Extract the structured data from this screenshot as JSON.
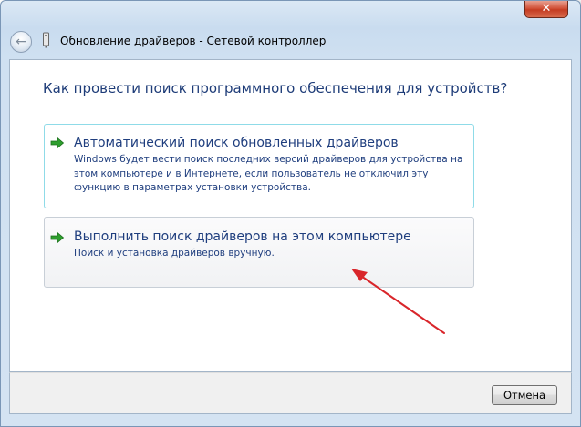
{
  "window": {
    "title": "Обновление драйверов - Сетевой контроллер",
    "close_label": "✕",
    "back_icon": "back-arrow-icon",
    "device_icon": "network-controller-icon"
  },
  "content": {
    "heading": "Как провести поиск программного обеспечения для устройств?",
    "options": [
      {
        "icon": "green-arrow-icon",
        "title": "Автоматический поиск обновленных драйверов",
        "description": "Windows будет вести поиск последних версий драйверов для устройства на\nэтом компьютере и в Интернете, если пользователь не отключил эту\nфункцию в параметрах установки устройства."
      },
      {
        "icon": "green-arrow-icon",
        "title": "Выполнить поиск драйверов на этом компьютере",
        "description": "Поиск и установка драйверов вручную."
      }
    ]
  },
  "annotation": {
    "color": "#d9262b"
  },
  "footer": {
    "cancel_label": "Отмена"
  },
  "colors": {
    "accent_text": "#1f3e7e",
    "close_red": "#c43c22",
    "arrow_green": "#2e9e2e"
  }
}
